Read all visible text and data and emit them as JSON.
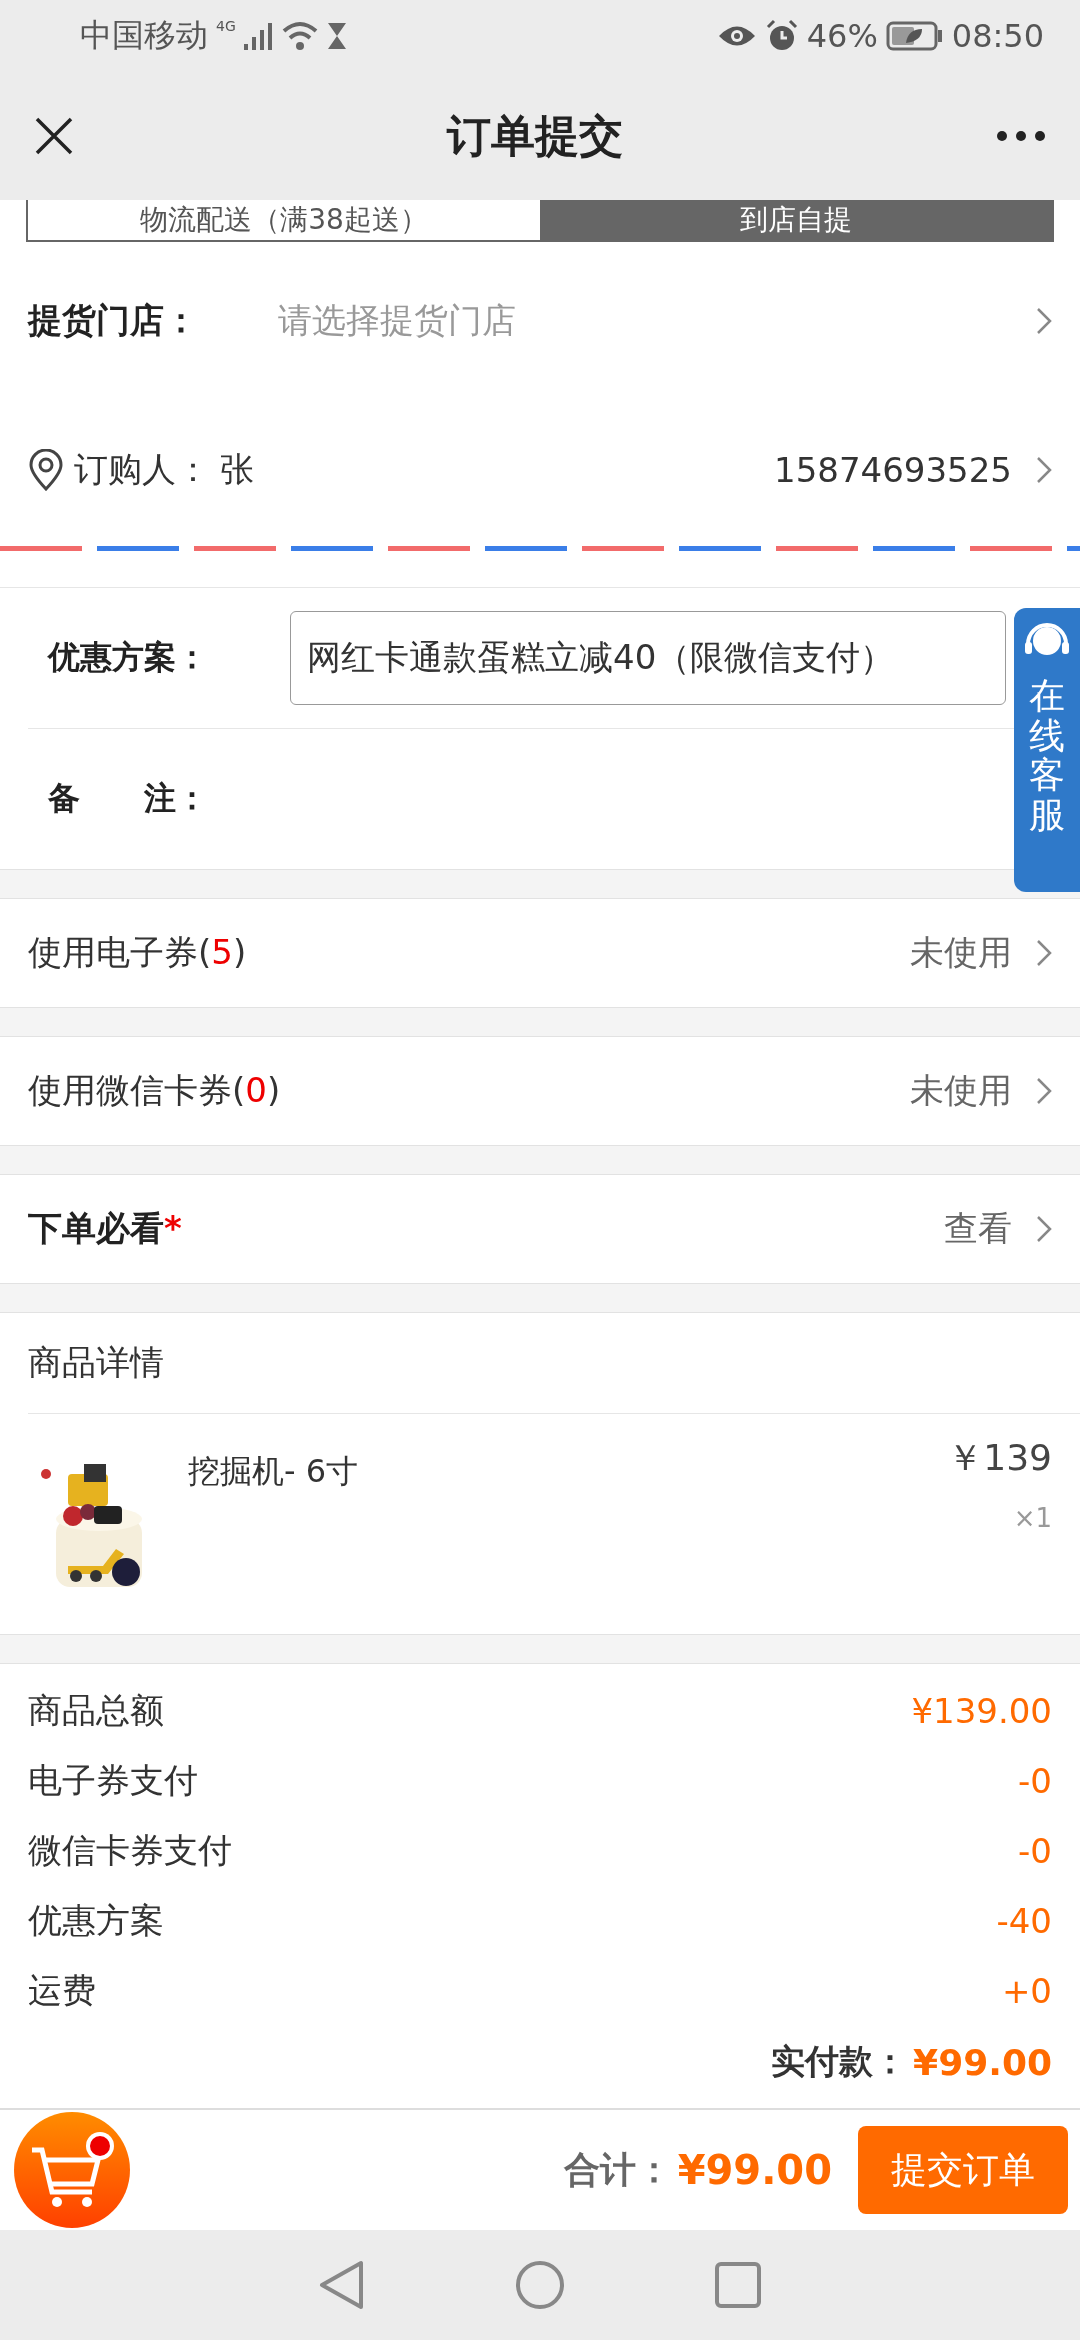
{
  "status_bar": {
    "carrier": "中国移动",
    "network": "4G",
    "battery": "46%",
    "time": "08:50"
  },
  "header": {
    "title": "订单提交"
  },
  "delivery_tabs": [
    {
      "label": "物流配送（满38起送）",
      "selected": false
    },
    {
      "label": "到店自提",
      "selected": true
    }
  ],
  "pickup_store": {
    "label": "提货门店：",
    "placeholder": "请选择提货门店"
  },
  "buyer": {
    "label": "订购人：",
    "name": "张",
    "phone": "15874693525"
  },
  "promotion": {
    "label": "优惠方案：",
    "value": "网红卡通款蛋糕立减40（限微信支付）"
  },
  "remark": {
    "label": "备　　注："
  },
  "coupons": [
    {
      "prefix": "使用电子券(",
      "count": "5",
      "suffix": ")",
      "status": "未使用"
    },
    {
      "prefix": "使用微信卡券(",
      "count": "0",
      "suffix": ")",
      "status": "未使用"
    }
  ],
  "notice": {
    "label": "下单必看",
    "mark": "*",
    "action": "查看"
  },
  "products": {
    "title": "商品详情",
    "items": [
      {
        "name": "挖掘机- 6寸",
        "price": "￥139",
        "quantity": "×1"
      }
    ]
  },
  "summary": {
    "rows": [
      {
        "label": "商品总额",
        "value": "¥139.00"
      },
      {
        "label": "电子券支付",
        "value": "-0"
      },
      {
        "label": "微信卡券支付",
        "value": "-0"
      },
      {
        "label": "优惠方案",
        "value": "-40"
      },
      {
        "label": "运费",
        "value": "+0"
      }
    ],
    "paid_label": "实付款：",
    "paid": "¥99.00"
  },
  "bottom_bar": {
    "total_label": "合计：",
    "total": "¥99.00",
    "submit": "提交订单"
  },
  "service_tab": {
    "label": "在线客服"
  }
}
